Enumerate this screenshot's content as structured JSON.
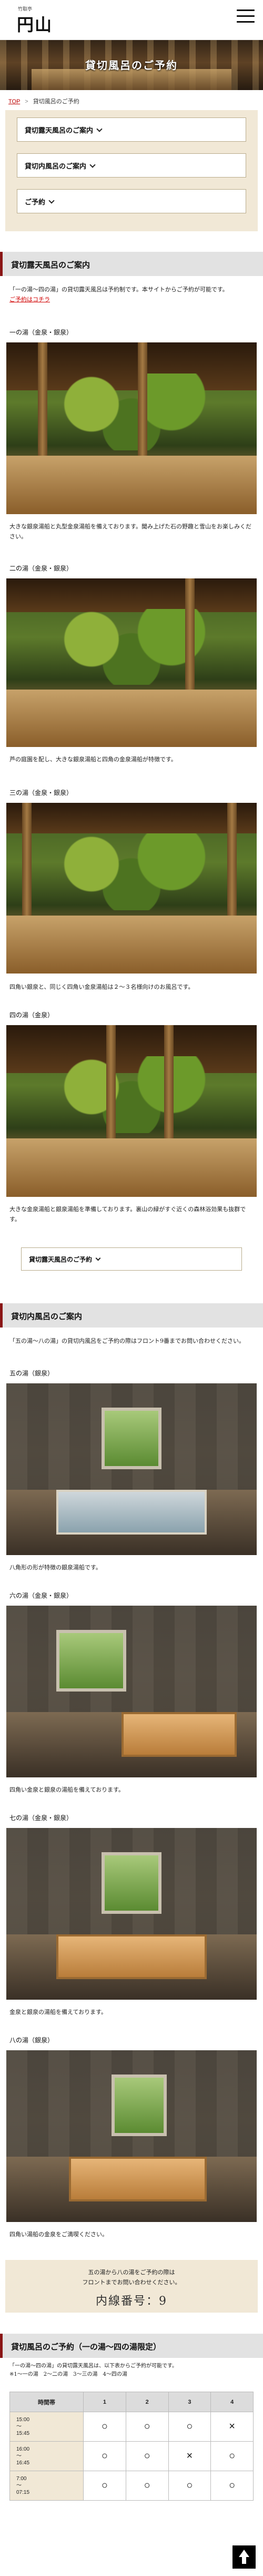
{
  "header": {
    "logo_small": "竹取亭",
    "logo_main": "円山",
    "logo_sub": "竹取亭"
  },
  "hero": {
    "title": "貸切風呂のご予約"
  },
  "breadcrumb": {
    "home": "TOP",
    "separator": ">",
    "current": "貸切風呂のご予約"
  },
  "anchors": [
    {
      "label": "貸切露天風呂のご案内"
    },
    {
      "label": "貸切内風呂のご案内"
    },
    {
      "label": "ご予約"
    }
  ],
  "outdoor": {
    "heading": "貸切露天風呂のご案内",
    "intro_1": "「一の湯～四の湯」の貸切露天風呂は予約制です。本サイトからご予約が可能です。",
    "intro_link": "ご予約はコチラ",
    "baths": [
      {
        "title": "一の湯（金泉・銀泉）",
        "desc": "大きな銀泉湯船と丸型金泉湯船を備えております。聞み上げた石の野趣と雪山をお楽しみください。"
      },
      {
        "title": "二の湯（金泉・銀泉）",
        "desc": "芦の庭園を配し、大きな銀泉湯船と四角の金泉湯船が特徴です。"
      },
      {
        "title": "三の湯（金泉・銀泉）",
        "desc": "四角い銀泉と、同じく四角い金泉湯船は２～３名様向けのお風呂です。"
      },
      {
        "title": "四の湯（金泉）",
        "desc": "大きな金泉湯船と銀泉湯船を準備しております。裏山の緑がすぐ近くの森林浴効果も抜群です。"
      }
    ],
    "reserve_button": "貸切露天風呂のご予約"
  },
  "indoor": {
    "heading": "貸切内風呂のご案内",
    "intro": "「五の湯～八の湯」の貸切内風呂をご予約の際はフロント9番までお問い合わせください。",
    "baths": [
      {
        "title": "五の湯（銀泉）",
        "desc": "八角形の形が特徴の銀泉湯船です。"
      },
      {
        "title": "六の湯（金泉・銀泉）",
        "desc": "四角い金泉と銀泉の湯船を備えております。"
      },
      {
        "title": "七の湯（金泉・銀泉）",
        "desc": "金泉と銀泉の湯船を備えております。"
      },
      {
        "title": "八の湯（銀泉）",
        "desc": "四角い湯船の金泉をご満喫ください。"
      }
    ],
    "info_line1": "五の湯から八の湯をご予約の際は",
    "info_line2": "フロントまでお問い合わせください。",
    "info_number": "内線番号：9"
  },
  "reservation": {
    "heading": "貸切風呂のご予約（一の湯～四の湯限定）",
    "intro": "「一の湯～四の湯」の貸切露天風呂は、以下表からご予約が可能です。",
    "legend": "※1～一の湯　2～二の湯　3～三の湯　4～四の湯",
    "columns": [
      "時間帯",
      "1",
      "2",
      "3",
      "4"
    ],
    "rows": [
      {
        "time": "15:00\n～\n15:45",
        "marks": [
          "○",
          "○",
          "○",
          "×"
        ]
      },
      {
        "time": "16:00\n～\n16:45",
        "marks": [
          "○",
          "○",
          "×",
          "○"
        ]
      },
      {
        "time": "7:00\n～\n07:15",
        "marks": [
          "○",
          "○",
          "○",
          "○"
        ]
      }
    ]
  },
  "colors": {
    "accent": "#8a1616",
    "tan": "#f1e8d6",
    "red_text": "#d00000"
  }
}
